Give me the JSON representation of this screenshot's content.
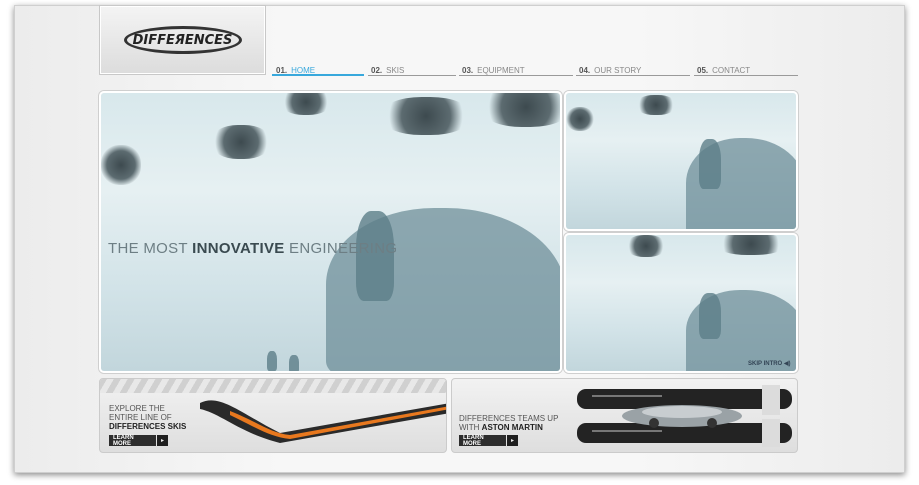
{
  "brand": {
    "logo_text": "DIFFEЯENCES"
  },
  "nav": [
    {
      "num": "01.",
      "label": "HOME",
      "active": true
    },
    {
      "num": "02.",
      "label": "SKIS",
      "active": false
    },
    {
      "num": "03.",
      "label": "EQUIPMENT",
      "active": false
    },
    {
      "num": "04.",
      "label": "OUR STORY",
      "active": false
    },
    {
      "num": "05.",
      "label": "CONTACT",
      "active": false
    }
  ],
  "hero": {
    "headline_pre": "THE MOST ",
    "headline_bold": "INNOVATIVE",
    "headline_post": " ENGINEERING",
    "skip_label": "SKIP INTRO",
    "sound_icon": "speaker-icon"
  },
  "promos": [
    {
      "line1": "EXPLORE THE",
      "line2": "ENTIRE LINE OF",
      "line3_bold": "DIFFERENCES SKIS",
      "button": "LEARN MORE"
    },
    {
      "line1": "DIFFERENCES TEAMS UP",
      "line2_pre": "WITH ",
      "line2_bold": "ASTON MARTIN",
      "button": "LEARN MORE"
    }
  ],
  "colors": {
    "accent": "#38a8dc",
    "ski_orange": "#e8781e"
  }
}
